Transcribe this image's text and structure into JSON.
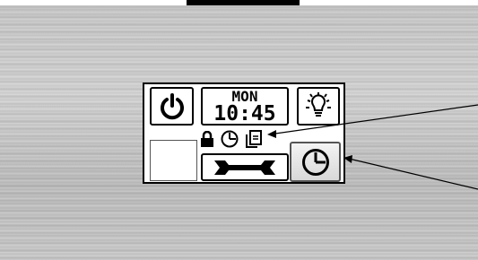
{
  "clock": {
    "day": "MON",
    "time": "10:45"
  },
  "icons": {
    "power": "power-icon",
    "light": "light-bulb-icon",
    "lock": "lock-icon",
    "timer_status": "timer-icon",
    "external_device": "external-device-icon",
    "tools": "wrench-icon",
    "timer_button": "timer-icon"
  },
  "colors": {
    "screen_background": "#ffffff",
    "icon": "#000000",
    "panel": "#c8c8c8"
  }
}
